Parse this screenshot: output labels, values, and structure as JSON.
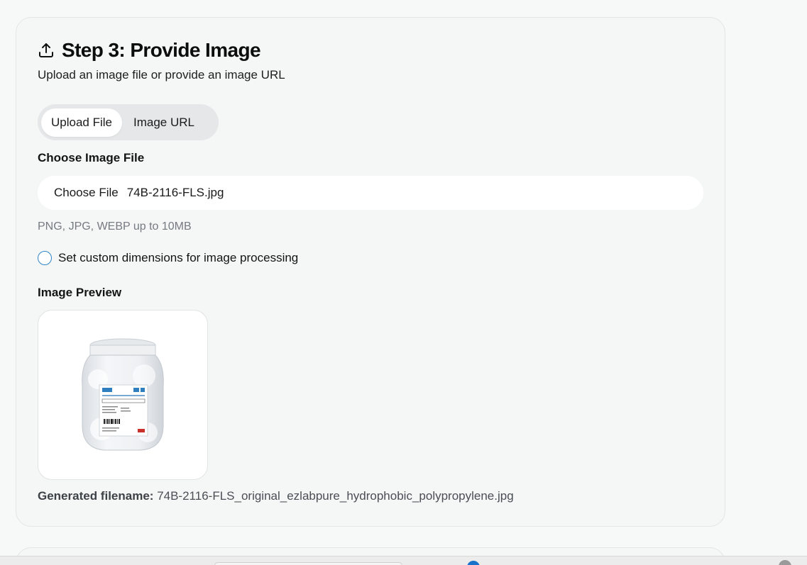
{
  "step": {
    "title": "Step 3: Provide Image",
    "subtitle": "Upload an image file or provide an image URL",
    "icon": "upload-icon"
  },
  "tabs": [
    {
      "label": "Upload File",
      "active": true
    },
    {
      "label": "Image URL",
      "active": false
    }
  ],
  "file_section": {
    "label": "Choose Image File",
    "button_label": "Choose File",
    "selected_file": "74B-2116-FLS.jpg",
    "hint": "PNG, JPG, WEBP up to 10MB"
  },
  "custom_dimensions": {
    "label": "Set custom dimensions for image processing",
    "checked": false
  },
  "preview": {
    "label": "Image Preview"
  },
  "generated": {
    "label": "Generated filename:",
    "value": "74B-2116-FLS_original_ezlabpure_hydrophobic_polypropylene.jpg"
  },
  "colors": {
    "accent": "#2f86c9",
    "card_bg": "#f5f6f6",
    "hint_text": "#757b82"
  }
}
